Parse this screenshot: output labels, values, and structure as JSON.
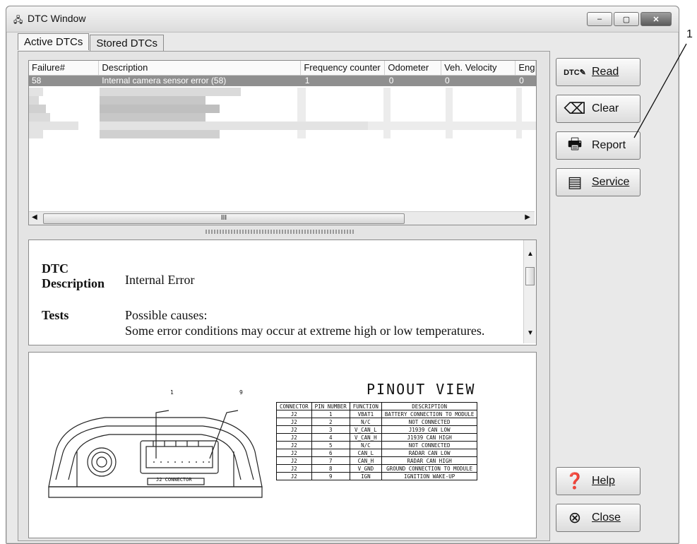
{
  "window": {
    "title": "DTC Window",
    "controls": [
      "–",
      "▢",
      "✕"
    ]
  },
  "tabs": [
    {
      "label": "Active DTCs"
    },
    {
      "label": "Stored DTCs"
    }
  ],
  "dtc_table": {
    "columns": [
      "Failure#",
      "Description",
      "Frequency counter",
      "Odometer",
      "Veh. Velocity",
      "Eng"
    ],
    "rows": [
      {
        "failure": "58",
        "description": "Internal camera sensor error (58)",
        "frequency": "1",
        "odometer": "0",
        "velocity": "0",
        "eng": "0"
      }
    ],
    "scroll_marker": "III"
  },
  "description": {
    "dtc_label": "DTC Description",
    "dtc_value": "Internal Error",
    "tests_label": "Tests",
    "tests_line1": "Possible causes:",
    "tests_line2": "Some error conditions may occur at extreme high or low temperatures."
  },
  "pinout": {
    "title": "PINOUT VIEW",
    "connector_label": "J2 CONNECTOR",
    "callouts": [
      "1",
      "9"
    ],
    "headers": [
      "CONNECTOR",
      "PIN NUMBER",
      "FUNCTION",
      "DESCRIPTION"
    ],
    "rows": [
      [
        "J2",
        "1",
        "VBAT1",
        "BATTERY CONNECTION TO MODULE"
      ],
      [
        "J2",
        "2",
        "N/C",
        "NOT CONNECTED"
      ],
      [
        "J2",
        "3",
        "V_CAN_L",
        "J1939 CAN LOW"
      ],
      [
        "J2",
        "4",
        "V_CAN_H",
        "J1939 CAN HIGH"
      ],
      [
        "J2",
        "5",
        "N/C",
        "NOT CONNECTED"
      ],
      [
        "J2",
        "6",
        "CAN_L",
        "RADAR CAN LOW"
      ],
      [
        "J2",
        "7",
        "CAN_H",
        "RADAR CAN HIGH"
      ],
      [
        "J2",
        "8",
        "V_GND",
        "GROUND CONNECTION TO MODULE"
      ],
      [
        "J2",
        "9",
        "IGN",
        "IGNITION WAKE-UP"
      ]
    ]
  },
  "buttons": {
    "read": "Read",
    "clear": "Clear",
    "report": "Report",
    "service": "Service",
    "help": "Help",
    "close": "Close"
  },
  "callout": "1"
}
